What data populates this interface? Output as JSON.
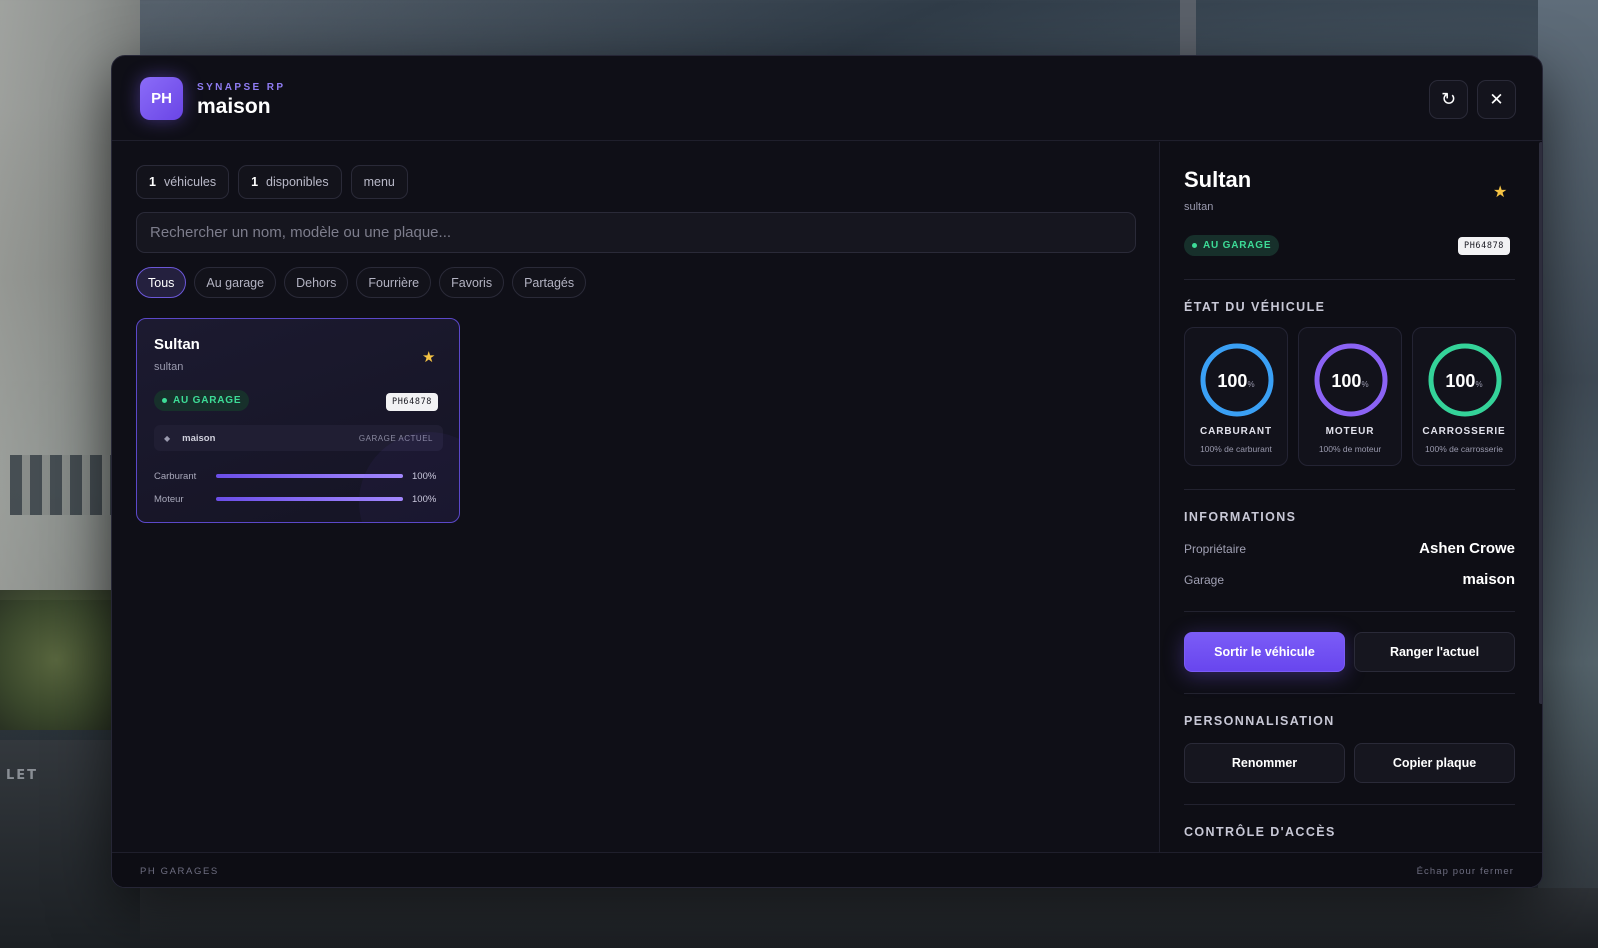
{
  "header": {
    "logo_text": "PH",
    "brand": "SYNAPSE RP",
    "title": "maison",
    "refresh_icon": "↻",
    "close_icon": "✕"
  },
  "background": {
    "car_text": "LET"
  },
  "stats": {
    "vehicles_count": "1",
    "vehicles_label": "véhicules",
    "available_count": "1",
    "available_label": "disponibles",
    "menu_label": "menu"
  },
  "search": {
    "placeholder": "Rechercher un nom, modèle ou une plaque..."
  },
  "filters": [
    {
      "label": "Tous",
      "active": true
    },
    {
      "label": "Au garage",
      "active": false
    },
    {
      "label": "Dehors",
      "active": false
    },
    {
      "label": "Fourrière",
      "active": false
    },
    {
      "label": "Favoris",
      "active": false
    },
    {
      "label": "Partagés",
      "active": false
    }
  ],
  "vehicle_card": {
    "name": "Sultan",
    "model": "sultan",
    "favorite_icon": "★",
    "status": "AU GARAGE",
    "plate": "PH64878",
    "location_icon": "◆",
    "location": "maison",
    "location_tag": "GARAGE ACTUEL",
    "bars": [
      {
        "label": "Carburant",
        "value": "100%",
        "percent": 100
      },
      {
        "label": "Moteur",
        "value": "100%",
        "percent": 100
      }
    ]
  },
  "detail": {
    "name": "Sultan",
    "model": "sultan",
    "favorite_icon": "★",
    "status": "AU GARAGE",
    "plate": "PH64878",
    "state_title": "ÉTAT DU VÉHICULE",
    "gauges": [
      {
        "value": "100",
        "unit": "%",
        "label": "CARBURANT",
        "sub": "100% de carburant",
        "color": "#3aa0f5",
        "percent": 100
      },
      {
        "value": "100",
        "unit": "%",
        "label": "MOTEUR",
        "sub": "100% de moteur",
        "color": "#8b63f5",
        "percent": 100
      },
      {
        "value": "100",
        "unit": "%",
        "label": "CARROSSERIE",
        "sub": "100% de carrosserie",
        "color": "#34d399",
        "percent": 100
      }
    ],
    "info_title": "INFORMATIONS",
    "owner_label": "Propriétaire",
    "owner_value": "Ashen Crowe",
    "garage_label": "Garage",
    "garage_value": "maison",
    "take_out_button": "Sortir le véhicule",
    "store_button": "Ranger l'actuel",
    "custom_title": "PERSONNALISATION",
    "rename_button": "Renommer",
    "copy_plate_button": "Copier plaque",
    "access_title": "CONTRÔLE D'ACCÈS"
  },
  "footer": {
    "left": "PH GARAGES",
    "right": "Échap pour fermer"
  }
}
